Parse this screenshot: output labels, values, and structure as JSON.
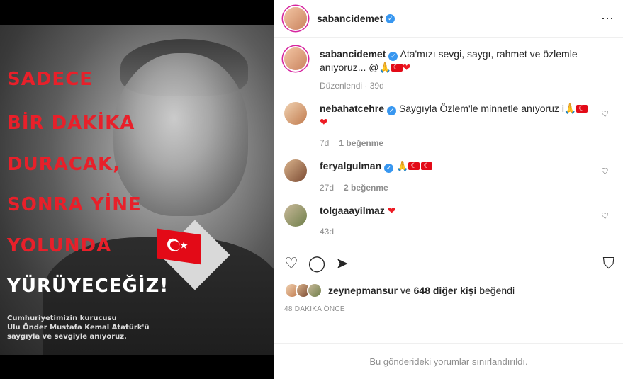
{
  "post": {
    "image_text": {
      "lines": [
        {
          "text": "SADECE",
          "color": "red"
        },
        {
          "text": "BİR DAKİKA",
          "color": "red"
        },
        {
          "text": "DURACAK,",
          "color": "red"
        },
        {
          "text": "SONRA YİNE",
          "color": "red"
        },
        {
          "text": "YOLUNDA",
          "color": "red"
        },
        {
          "text": "YÜRÜYECEĞİZ!",
          "color": "white"
        }
      ],
      "caption_lines": [
        "Cumhuriyetimizin kurucusu",
        "Ulu Önder Mustafa Kemal Atatürk'ü",
        "saygıyla ve sevgiyle anıyoruz."
      ]
    }
  },
  "header": {
    "username": "sabancidemet",
    "more_icon": "⋯"
  },
  "caption": {
    "username": "sabancidemet",
    "text": "Ata'mızı sevgi, saygı, rahmet ve özlemle anıyoruz... ",
    "emoji_tail": "@🙏",
    "edited": "Düzenlendi",
    "age": "39d"
  },
  "comments": [
    {
      "username": "nebahatcehre",
      "text": "Saygıyla Özlem'le minnetle anıyoruz i🙏",
      "age": "7d",
      "likes": "1 beğenme"
    },
    {
      "username": "feryalgulman",
      "text": "🙏",
      "age": "27d",
      "likes": "2 beğenme"
    },
    {
      "username": "tolgaaayilmaz",
      "text": "",
      "age": "43d",
      "likes": ""
    }
  ],
  "actions": {
    "like_icon": "heart-outline",
    "comment_icon": "comment",
    "share_icon": "send",
    "save_icon": "bookmark"
  },
  "likes": {
    "first_user": "zeynepmansur",
    "connector": "ve",
    "others": "648 diğer kişi",
    "suffix": "beğendi"
  },
  "timestamp": "48 DAKİKA ÖNCE",
  "footer_note": "Bu gönderideki yorumlar sınırlandırıldı."
}
